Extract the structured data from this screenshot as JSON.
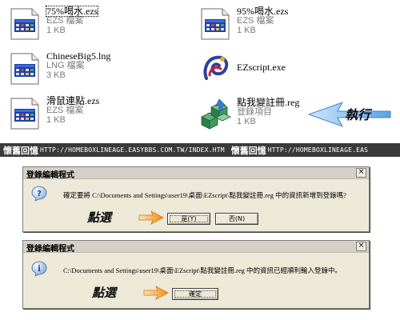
{
  "files": [
    {
      "name": "75%喝水.ezs",
      "type": "EZS 檔案",
      "size": "1 KB",
      "icon": "ezs-file-icon"
    },
    {
      "name": "95%喝水.ezs",
      "type": "EZS 檔案",
      "size": "1 KB",
      "icon": "ezs-file-icon"
    },
    {
      "name": "ChineseBig5.lng",
      "type": "LNG 檔案",
      "size": "3 KB",
      "icon": "lng-file-icon"
    },
    {
      "name": "EZscript.exe",
      "icon": "ezscript-app-icon"
    },
    {
      "name": "滑鼠連點.ezs",
      "type": "EZS 檔案",
      "size": "1 KB",
      "icon": "ezs-file-icon"
    },
    {
      "name": "點我變註冊.reg",
      "type": "登錄項目",
      "size": "1 KB",
      "icon": "registry-file-icon"
    }
  ],
  "callout": {
    "label": "執行",
    "color": "#6fb2e8"
  },
  "watermark": {
    "text_cn_1": "懷舊回憶",
    "url_1": "HTTP://HOMEBOXLINEAGE.EASYBBS.COM.TW/INDEX.HTM",
    "text_cn_2": "懷舊回憶",
    "url_2": "HTTP://HOMEBOXLINEAGE.EAS"
  },
  "dialog_confirm": {
    "title": "登錄編輯程式",
    "close": "×",
    "message": "確定要將 C:\\Documents and Settings\\user19\\桌面\\EZscript\\點我變註冊.reg 中的資訊新增到登錄嗎?",
    "yes_label": "是(Y)",
    "no_label": "否(N)",
    "click_label": "點選",
    "icon": "question-icon"
  },
  "dialog_result": {
    "title": "登錄編輯程式",
    "close": "×",
    "message": "C:\\Documents and Settings\\user19\\桌面\\EZscript\\點我變註冊.reg 中的資訊已經順利輸入登錄中。",
    "ok_label": "確定",
    "click_label": "點選",
    "icon": "info-icon"
  },
  "colors": {
    "dialog_bg": "#ece9d8",
    "watermark_bg": "#3a3a3a",
    "arrow_orange": "#f7941d",
    "arrow_blue": "#6fb2e8"
  }
}
